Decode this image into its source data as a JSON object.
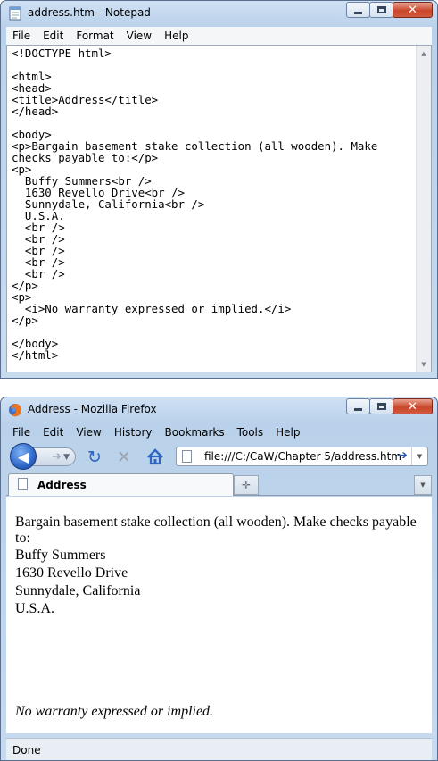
{
  "notepad": {
    "title": "address.htm - Notepad",
    "menu": [
      "File",
      "Edit",
      "Format",
      "View",
      "Help"
    ],
    "code_lines": [
      "<!DOCTYPE html>",
      "",
      "<html>",
      "<head>",
      "<title>Address</title>",
      "</head>",
      "",
      "<body>",
      "<p>Bargain basement stake collection (all wooden). Make",
      "checks payable to:</p>",
      "<p>",
      "  Buffy Summers<br />",
      "  1630 Revello Drive<br />",
      "  Sunnydale, California<br />",
      "  U.S.A.",
      "  <br />",
      "  <br />",
      "  <br />",
      "  <br />",
      "  <br />",
      "</p>",
      "<p>",
      "  <i>No warranty expressed or implied.</i>",
      "</p>",
      "",
      "</body>",
      "</html>"
    ]
  },
  "firefox": {
    "title": "Address - Mozilla Firefox",
    "menu": [
      "File",
      "Edit",
      "View",
      "History",
      "Bookmarks",
      "Tools",
      "Help"
    ],
    "url": "file:///C:/CaW/Chapter 5/address.htm",
    "tab_label": "Address",
    "content": {
      "paragraph1": "Bargain basement stake collection (all wooden). Make checks payable to:",
      "address_lines": [
        "Buffy Summers",
        "1630 Revello Drive",
        "Sunnydale, California",
        "U.S.A."
      ],
      "warranty": "No warranty expressed or implied."
    },
    "status": "Done"
  },
  "colors": {
    "frame": "#b9d1ea",
    "close_button": "#c9462a",
    "back_button": "#2a62c5"
  },
  "icons": [
    "notepad-icon",
    "firefox-icon",
    "minimize-icon",
    "maximize-icon",
    "close-icon",
    "back-icon",
    "forward-icon",
    "reload-icon",
    "stop-icon",
    "home-icon",
    "page-icon",
    "go-icon",
    "dropdown-icon",
    "new-tab-icon",
    "scroll-up-icon",
    "scroll-down-icon"
  ]
}
